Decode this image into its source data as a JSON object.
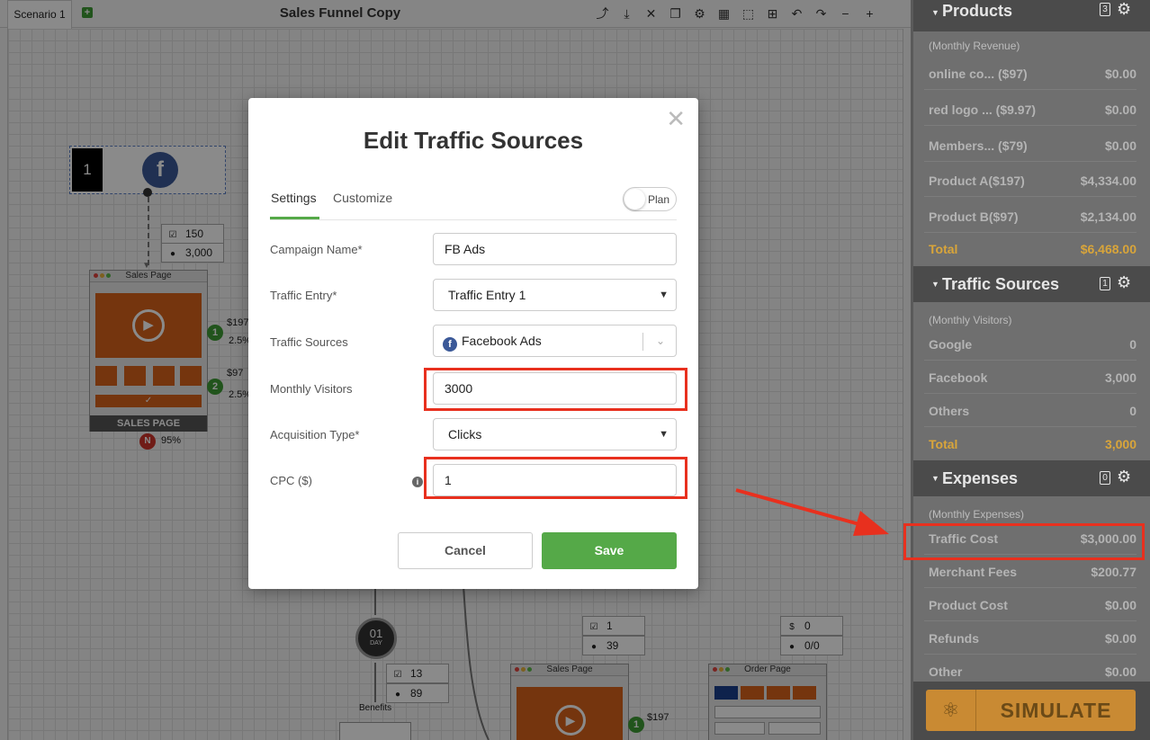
{
  "scenario_tab": "Scenario 1",
  "document_title": "Sales Funnel Copy",
  "canvas": {
    "source_number": "1",
    "stats_top": {
      "clicks": "150",
      "visitors": "3,000"
    },
    "sales_page_card": {
      "header": "Sales Page",
      "footer": "SALES PAGE"
    },
    "product_links": [
      {
        "num": "1",
        "price": "$197",
        "rate": "2.5%"
      },
      {
        "num": "2",
        "price": "$97",
        "rate": "2.5%"
      }
    ],
    "exit_badge": {
      "label": "N",
      "rate": "95%"
    },
    "delay_node": {
      "num": "01",
      "unit": "DAY"
    },
    "stats_mid": {
      "clicks": "13",
      "visitors": "89"
    },
    "benefits_label": "Benefits",
    "stats_right1": {
      "clicks": "1",
      "visitors": "39"
    },
    "stats_right2": {
      "money": "0",
      "ratio": "0/0"
    },
    "sales_page_card2": {
      "header": "Sales Page"
    },
    "order_page_card": {
      "header": "Order Page"
    },
    "bottom_link": {
      "num": "1",
      "price": "$197"
    }
  },
  "modal": {
    "title": "Edit Traffic Sources",
    "tabs": [
      "Settings",
      "Customize"
    ],
    "plan_label": "Plan",
    "fields": {
      "campaign_name": {
        "label": "Campaign Name*",
        "value": "FB Ads"
      },
      "traffic_entry": {
        "label": "Traffic Entry*",
        "value": "Traffic Entry 1"
      },
      "traffic_sources": {
        "label": "Traffic Sources",
        "value": "Facebook Ads"
      },
      "monthly_visitors": {
        "label": "Monthly Visitors",
        "value": "3000"
      },
      "acquisition_type": {
        "label": "Acquisition Type*",
        "value": "Clicks"
      },
      "cpc": {
        "label": "CPC ($)",
        "value": "1"
      }
    },
    "cancel_label": "Cancel",
    "save_label": "Save"
  },
  "panel": {
    "products": {
      "title": "Products",
      "count": "3",
      "subtitle": "(Monthly Revenue)",
      "rows": [
        {
          "name": "online co... ($97)",
          "value": "$0.00"
        },
        {
          "name": "red logo ... ($9.97)",
          "value": "$0.00"
        },
        {
          "name": "Members... ($79)",
          "value": "$0.00"
        },
        {
          "name": "Product A($197)",
          "value": "$4,334.00"
        },
        {
          "name": "Product B($97)",
          "value": "$2,134.00"
        }
      ],
      "total_label": "Total",
      "total_value": "$6,468.00"
    },
    "traffic": {
      "title": "Traffic Sources",
      "count": "1",
      "subtitle": "(Monthly Visitors)",
      "rows": [
        {
          "name": "Google",
          "value": "0"
        },
        {
          "name": "Facebook",
          "value": "3,000"
        },
        {
          "name": "Others",
          "value": "0"
        }
      ],
      "total_label": "Total",
      "total_value": "3,000"
    },
    "expenses": {
      "title": "Expenses",
      "count": "0",
      "subtitle": "(Monthly Expenses)",
      "rows": [
        {
          "name": "Traffic Cost",
          "value": "$3,000.00"
        },
        {
          "name": "Merchant Fees",
          "value": "$200.77"
        },
        {
          "name": "Product Cost",
          "value": "$0.00"
        },
        {
          "name": "Refunds",
          "value": "$0.00"
        },
        {
          "name": "Other",
          "value": "$0.00"
        }
      ]
    },
    "simulate_label": "SIMULATE"
  },
  "colors": {
    "accent_green": "#55a948",
    "total_gold": "#d9a53a",
    "highlight_red": "#e8301e",
    "facebook_blue": "#3b5998"
  }
}
